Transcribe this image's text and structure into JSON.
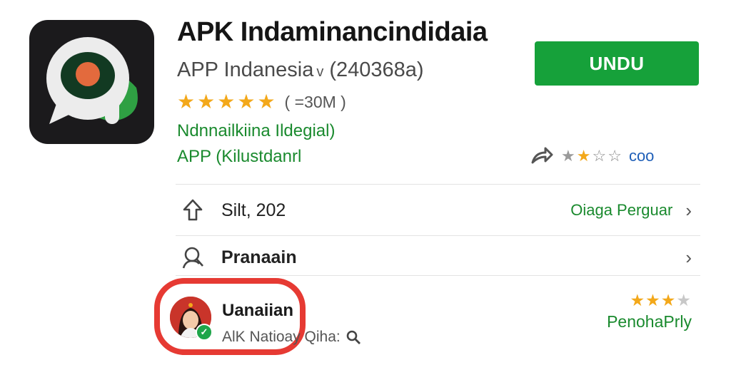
{
  "app": {
    "title": "APK Indaminancindidaia",
    "subtitle": "APP Indanesia",
    "subtitle_tag": "(240368a)",
    "rating_stars": 5,
    "reviews": "( =30M )",
    "developer": "Ndnnailkiina Ildegial)",
    "category": "APP (Kilustdanrl",
    "icon": "chat-bubble-record-icon"
  },
  "install_button": {
    "label": "UNDU",
    "color": "#16a13a"
  },
  "rate_widget": {
    "filled": 2,
    "total": 4,
    "label": "coo"
  },
  "rows": [
    {
      "icon": "upload-icon",
      "label": "Silt, 202",
      "link": "Oiaga Perguar"
    },
    {
      "icon": "magnify-person-icon",
      "label": "Pranaain"
    }
  ],
  "review": {
    "name": "Uanaiian",
    "meta": "AlK Natioay Qiha:",
    "stars_filled": 3,
    "stars_total": 4,
    "link": "PenohaPrly"
  },
  "colors": {
    "green": "#1a8a2e",
    "star": "#f3a81a",
    "highlight": "#e63a33",
    "blue": "#1f5fb8"
  }
}
